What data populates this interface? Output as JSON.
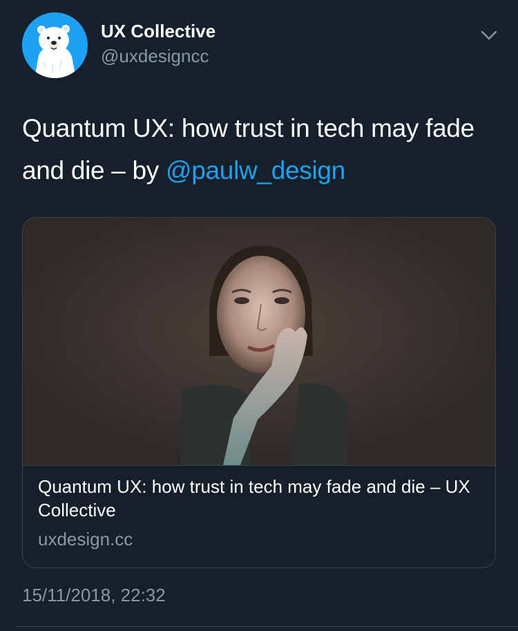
{
  "author": {
    "display_name": "UX Collective",
    "handle": "@uxdesigncc",
    "avatar_icon": "polar-bear-avatar"
  },
  "tweet": {
    "text_before_mention": "Quantum UX: how trust in tech may fade and die – by ",
    "mention": "@paulw_design"
  },
  "link_card": {
    "title": "Quantum UX: how trust in tech may fade and die – UX Collective",
    "domain": "uxdesign.cc",
    "image_description_icon": "woman-lit-by-screen-image"
  },
  "timestamp": "15/11/2018, 22:32",
  "menu_icon": "chevron-down-icon",
  "colors": {
    "background": "#15202b",
    "accent": "#1da1f2",
    "secondary_text": "#8899a6",
    "border": "#38444d"
  }
}
